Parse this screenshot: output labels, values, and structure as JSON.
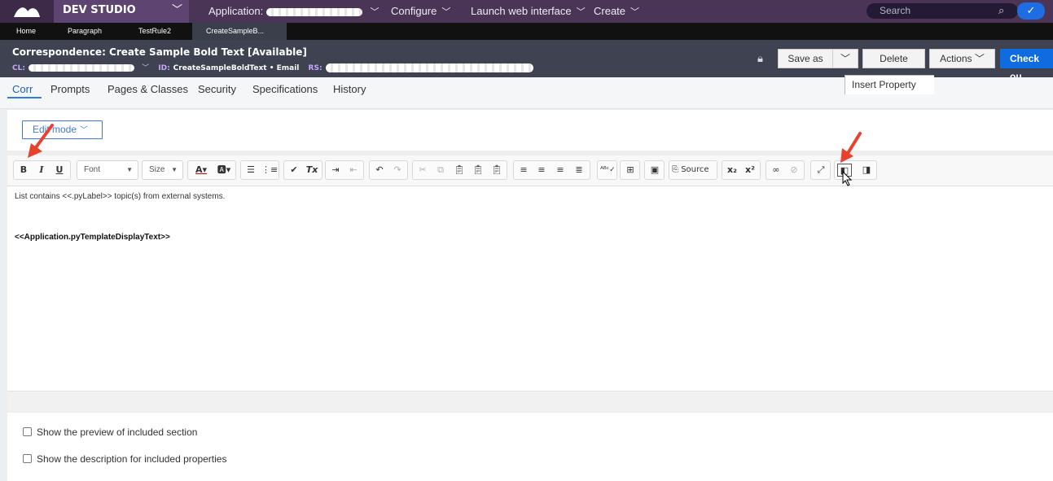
{
  "app": {
    "brand": "DEV STUDIO",
    "application_label": "Application:",
    "nav": [
      {
        "label": "Configure"
      },
      {
        "label": "Launch web interface"
      },
      {
        "label": "Create"
      }
    ],
    "search_placeholder": "Search"
  },
  "record_tabs": [
    {
      "label": "Home"
    },
    {
      "label": "Paragraph"
    },
    {
      "label": "TestRule2"
    },
    {
      "label": "CreateSampleB..."
    }
  ],
  "header": {
    "title": "Correspondence: Create Sample Bold Text [Available]",
    "cl_key": "CL:",
    "id_key": "ID:",
    "id_value": "CreateSampleBoldText • Email",
    "rs_key": "RS:",
    "buttons": {
      "save_as": "Save as",
      "delete": "Delete",
      "actions": "Actions",
      "check_out": "Check ou"
    }
  },
  "sub_tabs": [
    "Corr",
    "Prompts",
    "Pages & Classes",
    "Security",
    "Specifications",
    "History"
  ],
  "editor": {
    "mode_label": "Edit mode",
    "font_label": "Font",
    "size_label": "Size",
    "source_label": "Source",
    "tooltip": "Insert Property",
    "lines": [
      "List contains <<.pyLabel>> topic(s) from external systems.",
      "<<Application.pyTemplateDisplayText>>"
    ]
  },
  "options": [
    "Show the preview of included section",
    "Show the description for included properties"
  ],
  "colors": {
    "topbar": "#4b3557",
    "header": "#3f4250",
    "accent": "#0f6be0",
    "annotation_arrow": "#e8412c"
  }
}
